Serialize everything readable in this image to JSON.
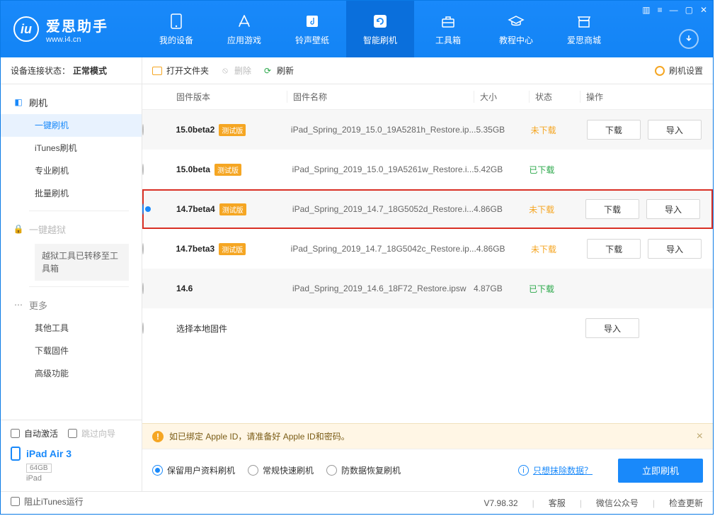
{
  "brand": {
    "title": "爱思助手",
    "sub": "www.i4.cn"
  },
  "nav": [
    {
      "id": "device",
      "label": "我的设备"
    },
    {
      "id": "apps",
      "label": "应用游戏"
    },
    {
      "id": "ring",
      "label": "铃声壁纸"
    },
    {
      "id": "flash",
      "label": "智能刷机"
    },
    {
      "id": "tools",
      "label": "工具箱"
    },
    {
      "id": "tutorial",
      "label": "教程中心"
    },
    {
      "id": "store",
      "label": "爱思商城"
    }
  ],
  "sidebar": {
    "status_label": "设备连接状态：",
    "status_value": "正常模式",
    "group_flash": "刷机",
    "items": [
      "一键刷机",
      "iTunes刷机",
      "专业刷机",
      "批量刷机"
    ],
    "group_jailbreak": "一键越狱",
    "jailbreak_note": "越狱工具已转移至工具箱",
    "group_more": "更多",
    "more_items": [
      "其他工具",
      "下载固件",
      "高级功能"
    ],
    "auto_activate": "自动激活",
    "skip_guide": "跳过向导",
    "device_name": "iPad Air 3",
    "device_capacity": "64GB",
    "device_type": "iPad"
  },
  "toolbar": {
    "open": "打开文件夹",
    "delete": "删除",
    "refresh": "刷新",
    "settings": "刷机设置"
  },
  "columns": {
    "version": "固件版本",
    "name": "固件名称",
    "size": "大小",
    "status": "状态",
    "ops": "操作"
  },
  "badge_label": "测试版",
  "firmware": [
    {
      "version": "15.0beta2",
      "beta": true,
      "name": "iPad_Spring_2019_15.0_19A5281h_Restore.ip...",
      "size": "5.35GB",
      "status": "未下载",
      "status_cls": "nd",
      "ops": [
        "下载",
        "导入"
      ],
      "selected": false
    },
    {
      "version": "15.0beta",
      "beta": true,
      "name": "iPad_Spring_2019_15.0_19A5261w_Restore.i...",
      "size": "5.42GB",
      "status": "已下载",
      "status_cls": "dd",
      "ops": [],
      "selected": false
    },
    {
      "version": "14.7beta4",
      "beta": true,
      "name": "iPad_Spring_2019_14.7_18G5052d_Restore.i...",
      "size": "4.86GB",
      "status": "未下载",
      "status_cls": "nd",
      "ops": [
        "下载",
        "导入"
      ],
      "selected": true
    },
    {
      "version": "14.7beta3",
      "beta": true,
      "name": "iPad_Spring_2019_14.7_18G5042c_Restore.ip...",
      "size": "4.86GB",
      "status": "未下载",
      "status_cls": "nd",
      "ops": [
        "下载",
        "导入"
      ],
      "selected": false
    },
    {
      "version": "14.6",
      "beta": false,
      "name": "iPad_Spring_2019_14.6_18F72_Restore.ipsw",
      "size": "4.87GB",
      "status": "已下载",
      "status_cls": "dd",
      "ops": [],
      "selected": false
    }
  ],
  "local_row": {
    "label": "选择本地固件",
    "op": "导入"
  },
  "notice": "如已绑定 Apple ID，请准备好 Apple ID和密码。",
  "flash_opts": {
    "keep": "保留用户资料刷机",
    "fast": "常规快速刷机",
    "antidata": "防数据恢复刷机",
    "erase_link": "只想抹除数据？",
    "go": "立即刷机"
  },
  "footer": {
    "block_itunes": "阻止iTunes运行",
    "version": "V7.98.32",
    "cs": "客服",
    "wechat": "微信公众号",
    "check_update": "检查更新"
  }
}
